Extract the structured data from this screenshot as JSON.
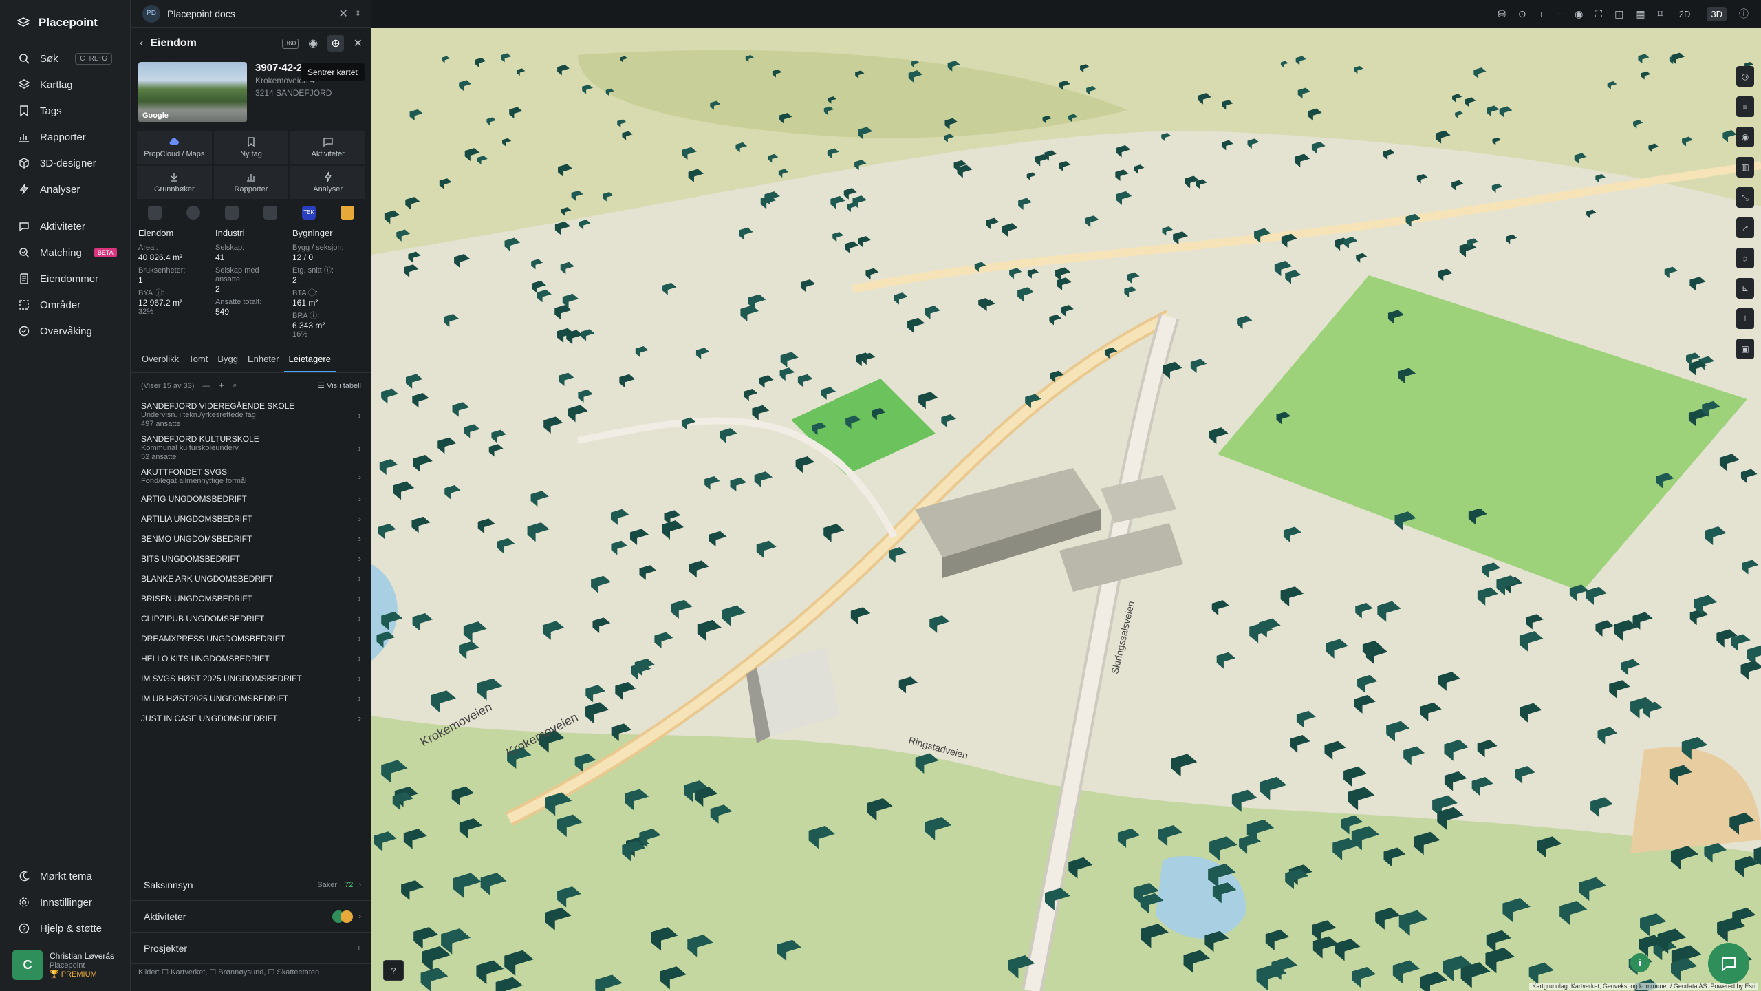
{
  "nav": {
    "brand": "Placepoint",
    "items": [
      {
        "label": "Søk",
        "kbd": "CTRL+G"
      },
      {
        "label": "Kartlag"
      },
      {
        "label": "Tags"
      },
      {
        "label": "Rapporter"
      },
      {
        "label": "3D-designer"
      },
      {
        "label": "Analyser"
      }
    ],
    "items2": [
      {
        "label": "Aktiviteter"
      },
      {
        "label": "Matching",
        "badge": "BETA"
      },
      {
        "label": "Eiendommer"
      },
      {
        "label": "Områder"
      },
      {
        "label": "Overvåking"
      }
    ],
    "bottom": [
      {
        "label": "Mørkt tema"
      },
      {
        "label": "Innstillinger"
      },
      {
        "label": "Hjelp & støtte"
      }
    ],
    "user": {
      "initial": "C",
      "name": "Christian Løverås",
      "org": "Placepoint",
      "plan": "PREMIUM"
    }
  },
  "panel": {
    "doc_tab": "Placepoint docs",
    "doc_initials": "PD",
    "header_title": "Eiendom",
    "tooltip": "Sentrer kartet",
    "property": {
      "id": "3907-42-284-0-0",
      "street": "Krokemoveien 4",
      "postal": "3214 SANDEFJORD",
      "google": "Google"
    },
    "actions": [
      {
        "label": "PropCloud / Maps"
      },
      {
        "label": "Ny tag"
      },
      {
        "label": "Aktiviteter"
      },
      {
        "label": "Grunnbøker"
      },
      {
        "label": "Rapporter"
      },
      {
        "label": "Analyser"
      }
    ],
    "stats": {
      "eiendom": {
        "head": "Eiendom",
        "areal_label": "Areal:",
        "areal": "40 826.4 m²",
        "bruks_label": "Bruksenheter:",
        "bruks": "1",
        "bya_label": "BYA ⓘ:",
        "bya": "12 967.2 m²",
        "bya_pct": "32%"
      },
      "industri": {
        "head": "Industri",
        "selskap_label": "Selskap:",
        "selskap": "41",
        "med_label": "Selskap med ansatte:",
        "med": "2",
        "ans_label": "Ansatte totalt:",
        "ans": "549"
      },
      "bygninger": {
        "head": "Bygninger",
        "bygg_label": "Bygg / seksjon:",
        "bygg": "12 / 0",
        "etg_label": "Etg. snitt ⓘ:",
        "etg": "2",
        "bta_label": "BTA ⓘ:",
        "bta": "161 m²",
        "bra_label": "BRA ⓘ:",
        "bra": "6 343 m²",
        "bra_pct": "16%"
      }
    },
    "tabs": [
      "Overblikk",
      "Tomt",
      "Bygg",
      "Enheter",
      "Leietagere"
    ],
    "list_meta": "(Viser 15 av 33)",
    "table_view": "Vis i tabell",
    "tenants": [
      {
        "name": "SANDEFJORD VIDEREGÅENDE SKOLE",
        "desc": "Undervisn. i tekn./yrkesrettede fag",
        "staff": "497 ansatte"
      },
      {
        "name": "SANDEFJORD KULTURSKOLE",
        "desc": "Kommunal kulturskoleunderv.",
        "staff": "52 ansatte"
      },
      {
        "name": "AKUTTFONDET SVGS",
        "desc": "Fond/legat allmennyttige formål",
        "staff": ""
      },
      {
        "name": "ARTIG UNGDOMSBEDRIFT"
      },
      {
        "name": "ARTILIA UNGDOMSBEDRIFT"
      },
      {
        "name": "BENMO UNGDOMSBEDRIFT"
      },
      {
        "name": "BITS UNGDOMSBEDRIFT"
      },
      {
        "name": "BLANKE ARK UNGDOMSBEDRIFT"
      },
      {
        "name": "BRISEN UNGDOMSBEDRIFT"
      },
      {
        "name": "CLIPZIPUB UNGDOMSBEDRIFT"
      },
      {
        "name": "DREAMXPRESS UNGDOMSBEDRIFT"
      },
      {
        "name": "HELLO KITS UNGDOMSBEDRIFT"
      },
      {
        "name": "IM SVGS HØST 2025 UNGDOMSBEDRIFT"
      },
      {
        "name": "IM UB HØST2025 UNGDOMSBEDRIFT"
      },
      {
        "name": "JUST IN CASE UNGDOMSBEDRIFT"
      }
    ],
    "accordions": {
      "saksinnsyn": "Saksinnsyn",
      "saker_label": "Saker:",
      "saker": "72",
      "aktiviteter": "Aktiviteter",
      "prosjekter": "Prosjekter"
    },
    "sources": "Kilder: ☐ Kartverket, ☐ Brønnøysund, ☐ Skatteetaten"
  },
  "topbar": {
    "mode_2d": "2D",
    "mode_3d": "3D"
  },
  "map": {
    "labels": [
      "Krokemoveien",
      "Krokemoveien",
      "Skiringssalsveien",
      "Ringstadveien"
    ],
    "attribution": "Kartgrunnlag: Kartverket, Geovekst og kommuner / Geodata AS. Powered by Esri",
    "colors": {
      "terrain": "#e7e5d3",
      "building": "#1f5a52",
      "park": "#7fbf6a",
      "road": "#f1ece4"
    }
  }
}
